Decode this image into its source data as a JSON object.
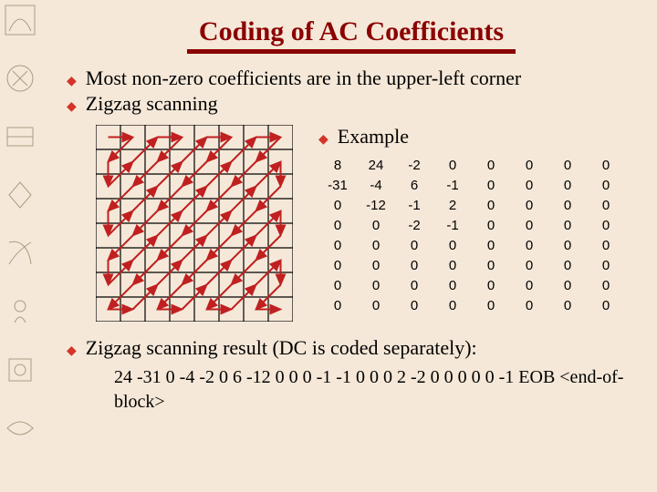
{
  "title": "Coding of AC Coefficients",
  "bullets": {
    "b1": "Most non-zero coefficients are in the upper-left corner",
    "b2": "Zigzag scanning",
    "example_label": "Example",
    "b3": "Zigzag scanning result (DC is coded separately):"
  },
  "matrix": [
    [
      "8",
      "24",
      "-2",
      "0",
      "0",
      "0",
      "0",
      "0"
    ],
    [
      "-31",
      "-4",
      "6",
      "-1",
      "0",
      "0",
      "0",
      "0"
    ],
    [
      "0",
      "-12",
      "-1",
      "2",
      "0",
      "0",
      "0",
      "0"
    ],
    [
      "0",
      "0",
      "-2",
      "-1",
      "0",
      "0",
      "0",
      "0"
    ],
    [
      "0",
      "0",
      "0",
      "0",
      "0",
      "0",
      "0",
      "0"
    ],
    [
      "0",
      "0",
      "0",
      "0",
      "0",
      "0",
      "0",
      "0"
    ],
    [
      "0",
      "0",
      "0",
      "0",
      "0",
      "0",
      "0",
      "0"
    ],
    [
      "0",
      "0",
      "0",
      "0",
      "0",
      "0",
      "0",
      "0"
    ]
  ],
  "zigzag_result": "24 -31 0 -4 -2 0 6 -12 0 0 0 -1 -1 0 0 0 2 -2 0 0 0 0 0 -1 EOB <end-of-block>",
  "chart_data": {
    "type": "table",
    "title": "8x8 quantized DCT coefficient block with zigzag scan diagram",
    "rows": 8,
    "cols": 8,
    "values": [
      [
        8,
        24,
        -2,
        0,
        0,
        0,
        0,
        0
      ],
      [
        -31,
        -4,
        6,
        -1,
        0,
        0,
        0,
        0
      ],
      [
        0,
        -12,
        -1,
        2,
        0,
        0,
        0,
        0
      ],
      [
        0,
        0,
        -2,
        -1,
        0,
        0,
        0,
        0
      ],
      [
        0,
        0,
        0,
        0,
        0,
        0,
        0,
        0
      ],
      [
        0,
        0,
        0,
        0,
        0,
        0,
        0,
        0
      ],
      [
        0,
        0,
        0,
        0,
        0,
        0,
        0,
        0
      ],
      [
        0,
        0,
        0,
        0,
        0,
        0,
        0,
        0
      ]
    ],
    "diagram": "zigzag traversal arrows over 8x8 grid"
  }
}
